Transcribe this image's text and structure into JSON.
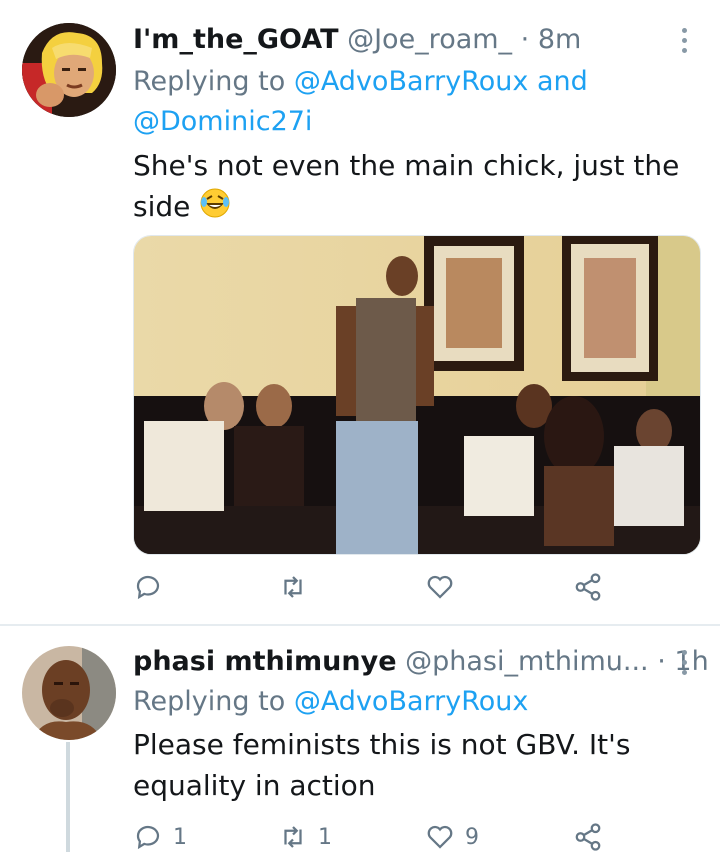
{
  "tweets": [
    {
      "display_name": "I'm_the_GOAT",
      "handle": "@Joe_roam_",
      "time": "8m",
      "replying_label": "Replying to",
      "replying_to_1": "@AdvoBarryRoux",
      "replying_and": "and",
      "replying_to_2": "@Dominic27i",
      "text_line1": "She's not even the main chick, just the",
      "text_line2": "side",
      "emoji": "rolling-on-floor-laughing-emoji",
      "has_photo": true,
      "counts": {
        "reply": "",
        "retweet": "",
        "like": "",
        "share": ""
      }
    },
    {
      "display_name": "phasi mthimunye",
      "handle": "@phasi_mthimu...",
      "time": "1h",
      "replying_label": "Replying to",
      "replying_to_1": "@AdvoBarryRoux",
      "text_line1": "Please feminists this is not GBV. It's",
      "text_line2": "equality in action",
      "counts": {
        "reply": "1",
        "retweet": "1",
        "like": "9",
        "share": ""
      }
    }
  ],
  "colors": {
    "link": "#1da1f2",
    "muted": "#657786",
    "divider": "#e6ecf0"
  },
  "icons": [
    "reply-icon",
    "retweet-icon",
    "like-icon",
    "share-icon",
    "more-options-icon"
  ]
}
